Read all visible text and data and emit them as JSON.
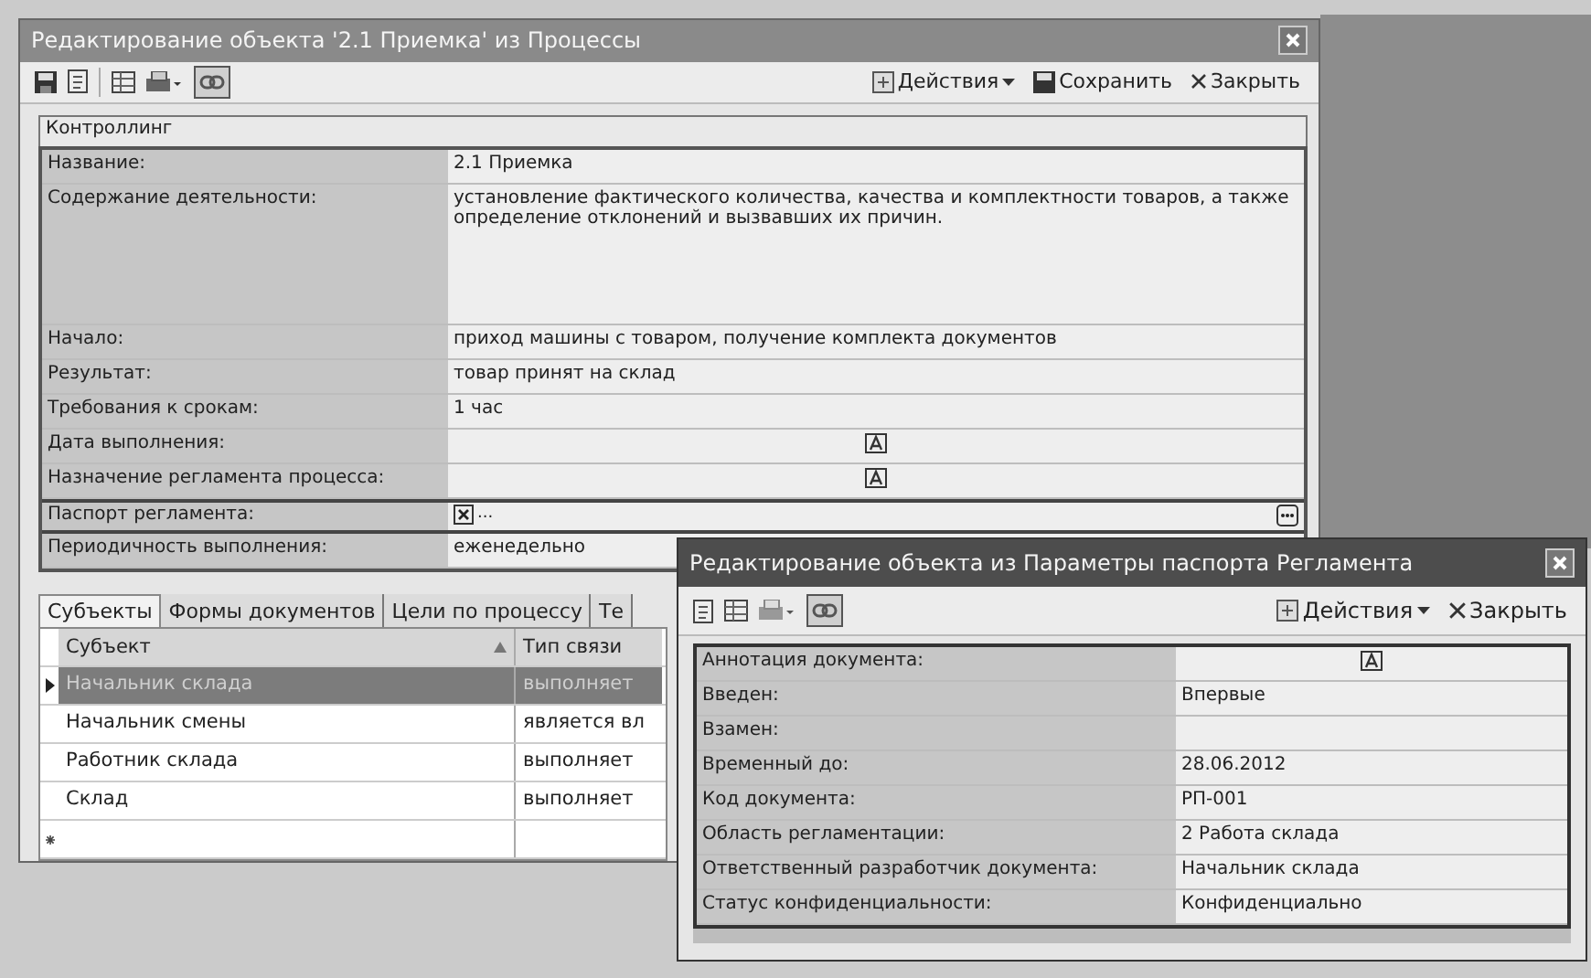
{
  "main_window": {
    "title": "Редактирование объекта '2.1 Приемка' из Процессы",
    "toolbar": {
      "actions": "Действия",
      "save": "Сохранить",
      "close": "Закрыть"
    },
    "group": "Контроллинг",
    "properties": [
      {
        "label": "Название:",
        "kind": "text",
        "value": "2.1 Приемка"
      },
      {
        "label": "Содержание деятельности:",
        "kind": "multiline",
        "value": "установление фактического количества, качества и комплектности товаров, а также определение отклонений и вызвавших их причин."
      },
      {
        "label": "Начало:",
        "kind": "text",
        "value": "приход машины с товаром, получение комплекта документов"
      },
      {
        "label": "Результат:",
        "kind": "text",
        "value": "товар принят на склад"
      },
      {
        "label": "Требования к срокам:",
        "kind": "text",
        "value": "1 час"
      },
      {
        "label": "Дата выполнения:",
        "kind": "icon"
      },
      {
        "label": "Назначение регламента процесса:",
        "kind": "icon"
      },
      {
        "label": "Паспорт регламента:",
        "kind": "reference",
        "value": "..."
      },
      {
        "label": "Периодичность выполнения:",
        "kind": "text",
        "value": "еженедельно"
      }
    ],
    "tabs": [
      {
        "label": "Субъекты",
        "selected": true
      },
      {
        "label": "Формы документов",
        "selected": false
      },
      {
        "label": "Цели по процессу",
        "selected": false
      },
      {
        "label": "Те",
        "selected": false
      }
    ],
    "table": {
      "columns": [
        "Субъект",
        "Тип связи"
      ],
      "rows": [
        {
          "cells": [
            "Начальник склада",
            "выполняет"
          ],
          "selected": true
        },
        {
          "cells": [
            "Начальник смены",
            "является вл"
          ],
          "selected": false
        },
        {
          "cells": [
            "Работник склада",
            "выполняет"
          ],
          "selected": false
        },
        {
          "cells": [
            "Склад",
            "выполняет"
          ],
          "selected": false
        }
      ]
    }
  },
  "sub_window": {
    "title": "Редактирование объекта из Параметры паспорта Регламента",
    "toolbar": {
      "actions": "Действия",
      "close": "Закрыть"
    },
    "properties": [
      {
        "label": "Аннотация документа:",
        "kind": "icon"
      },
      {
        "label": "Введен:",
        "kind": "text",
        "value": "Впервые"
      },
      {
        "label": "Взамен:",
        "kind": "text"
      },
      {
        "label": "Временный до:",
        "kind": "text",
        "value": "28.06.2012"
      },
      {
        "label": "Код документа:",
        "kind": "text",
        "value": "РП-001"
      },
      {
        "label": "Область регламентации:",
        "kind": "text",
        "value": "2 Работа склада"
      },
      {
        "label": "Ответственный разработчик документа:",
        "kind": "text",
        "value": "Начальник склада"
      },
      {
        "label": "Статус конфиденциальности:",
        "kind": "text",
        "value": "Конфиденциально"
      }
    ]
  }
}
